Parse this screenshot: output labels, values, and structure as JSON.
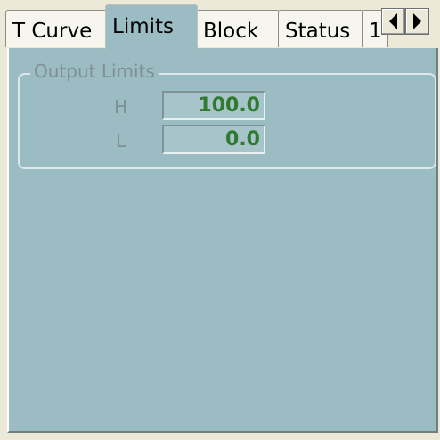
{
  "tabs": [
    {
      "label": "T Curve",
      "active": false
    },
    {
      "label": "Limits",
      "active": true
    },
    {
      "label": "Block",
      "active": false
    },
    {
      "label": "Status",
      "active": false
    },
    {
      "label": "1",
      "active": false
    }
  ],
  "scroll": {
    "left_icon": "arrow-left-icon",
    "right_icon": "arrow-right-icon"
  },
  "output_limits": {
    "title": "Output Limits",
    "high": {
      "label": "H",
      "value": "100.0"
    },
    "low": {
      "label": "L",
      "value": "0.0"
    }
  },
  "colors": {
    "panel": "#9bbcc3",
    "value_text": "#2f7a2f",
    "label_text": "#7f8f93"
  }
}
